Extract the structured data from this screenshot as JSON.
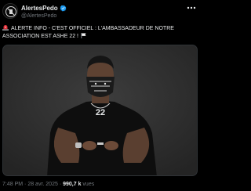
{
  "account": {
    "display_name": "AlertesPedo",
    "handle": "@AlertesPedo",
    "verified": true
  },
  "tweet": {
    "line1": "ALERTE INFO - C'EST OFFICIEL : L'AMBASSADEUR DE NOTRE",
    "line2": "ASSOCIATION EST ASHE 22 !"
  },
  "media": {
    "jersey_number": "22"
  },
  "meta": {
    "time": "7:48 PM",
    "date": "28 avr. 2025",
    "separator": "·",
    "views_count": "990,7 k",
    "views_label": "vues"
  },
  "icons": {
    "verified": "verified-badge-icon",
    "more": "more-options-icon",
    "alert": "rotating-light-emoji",
    "flag": "white-flag-emoji"
  },
  "colors": {
    "background": "#000000",
    "text": "#e7e9ea",
    "secondary": "#71767b",
    "verified": "#1d9bf0"
  }
}
